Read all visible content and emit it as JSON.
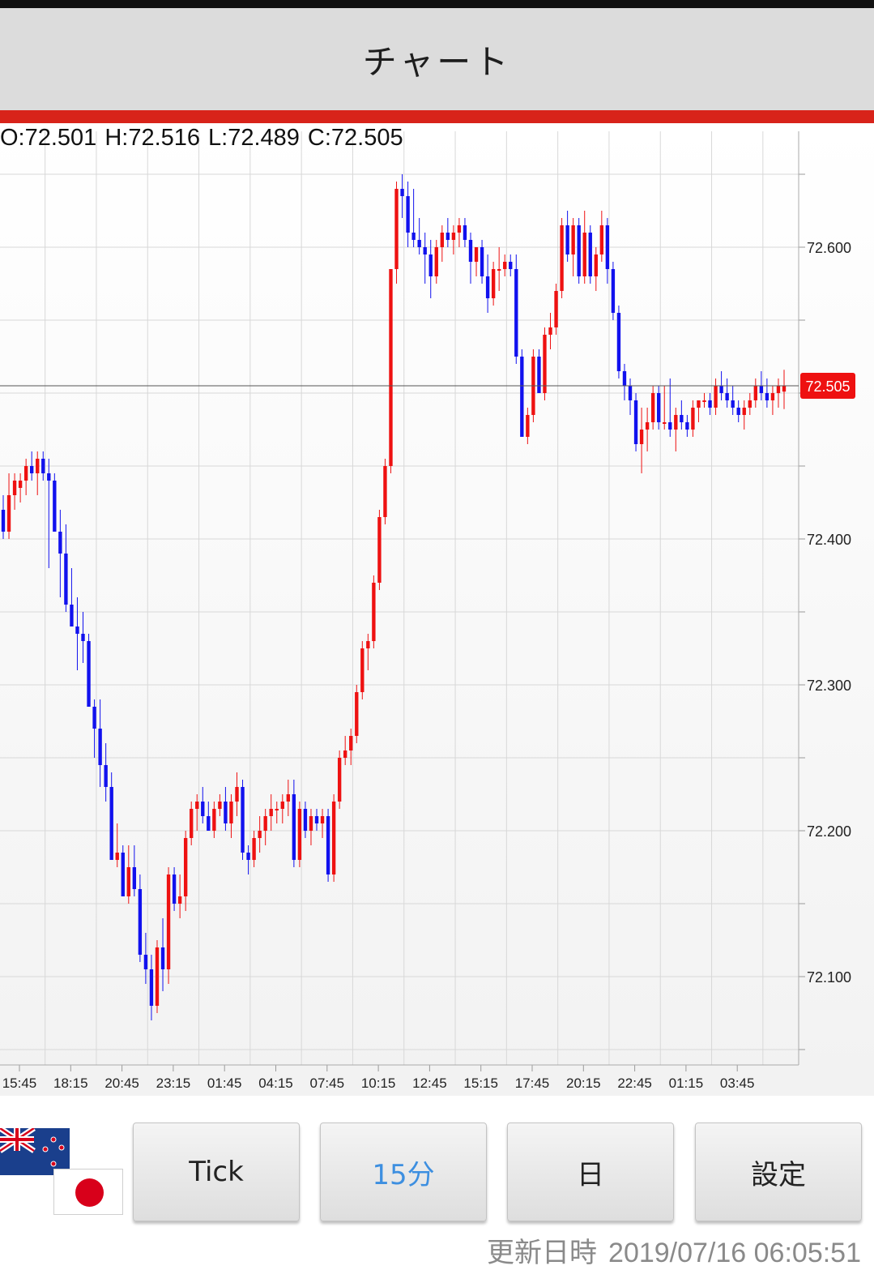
{
  "header": {
    "title": "チャート"
  },
  "ohlc": {
    "open": "O:72.501",
    "high": "H:72.516",
    "low": "L:72.489",
    "close": "C:72.505"
  },
  "buttons": {
    "tick": "Tick",
    "m15": "15分",
    "day": "日",
    "settings": "設定"
  },
  "footer": {
    "update_label": "更新日時",
    "update_value": "2019/07/16 06:05:51"
  },
  "colors": {
    "up": "#ee1111",
    "down": "#1111ee",
    "accent": "#d8231a",
    "header_bg": "#dcdcdc",
    "active_button_text": "#3d8fe0"
  },
  "icons": {
    "flag_top": "new-zealand-flag-icon",
    "flag_bottom": "japan-flag-icon"
  },
  "chart_data": {
    "type": "candlestick",
    "ylim": [
      72.045,
      72.665
    ],
    "yticks": [
      72.1,
      72.2,
      72.3,
      72.4,
      72.6
    ],
    "ytick_labels": [
      "72.100",
      "72.200",
      "72.300",
      "72.400",
      "72.600"
    ],
    "x_tick_labels": [
      "15:45",
      "18:15",
      "20:45",
      "23:15",
      "01:45",
      "04:15",
      "07:45",
      "10:15",
      "12:45",
      "15:15",
      "17:45",
      "20:15",
      "22:45",
      "01:15",
      "03:45"
    ],
    "current_price": 72.505,
    "current_price_label": "72.505",
    "grid": true,
    "candles": [
      [
        72.42,
        72.43,
        72.4,
        72.405
      ],
      [
        72.405,
        72.445,
        72.4,
        72.43
      ],
      [
        72.43,
        72.445,
        72.42,
        72.44
      ],
      [
        72.435,
        72.445,
        72.425,
        72.44
      ],
      [
        72.44,
        72.455,
        72.43,
        72.45
      ],
      [
        72.45,
        72.46,
        72.44,
        72.445
      ],
      [
        72.445,
        72.46,
        72.43,
        72.455
      ],
      [
        72.455,
        72.46,
        72.44,
        72.445
      ],
      [
        72.445,
        72.455,
        72.38,
        72.44
      ],
      [
        72.44,
        72.445,
        72.405,
        72.405
      ],
      [
        72.405,
        72.42,
        72.36,
        72.39
      ],
      [
        72.39,
        72.41,
        72.35,
        72.355
      ],
      [
        72.355,
        72.38,
        72.34,
        72.34
      ],
      [
        72.34,
        72.36,
        72.31,
        72.335
      ],
      [
        72.335,
        72.35,
        72.315,
        72.33
      ],
      [
        72.33,
        72.335,
        72.285,
        72.285
      ],
      [
        72.285,
        72.29,
        72.25,
        72.27
      ],
      [
        72.27,
        72.29,
        72.23,
        72.245
      ],
      [
        72.245,
        72.26,
        72.22,
        72.23
      ],
      [
        72.23,
        72.24,
        72.18,
        72.18
      ],
      [
        72.18,
        72.205,
        72.175,
        72.185
      ],
      [
        72.185,
        72.19,
        72.155,
        72.155
      ],
      [
        72.155,
        72.19,
        72.15,
        72.175
      ],
      [
        72.175,
        72.19,
        72.155,
        72.16
      ],
      [
        72.16,
        72.17,
        72.11,
        72.115
      ],
      [
        72.115,
        72.13,
        72.095,
        72.105
      ],
      [
        72.105,
        72.115,
        72.07,
        72.08
      ],
      [
        72.08,
        72.125,
        72.075,
        72.12
      ],
      [
        72.12,
        72.14,
        72.09,
        72.105
      ],
      [
        72.105,
        72.175,
        72.095,
        72.17
      ],
      [
        72.17,
        72.175,
        72.145,
        72.15
      ],
      [
        72.15,
        72.17,
        72.14,
        72.155
      ],
      [
        72.155,
        72.2,
        72.145,
        72.195
      ],
      [
        72.195,
        72.22,
        72.19,
        72.215
      ],
      [
        72.215,
        72.225,
        72.2,
        72.22
      ],
      [
        72.22,
        72.23,
        72.205,
        72.21
      ],
      [
        72.21,
        72.22,
        72.2,
        72.2
      ],
      [
        72.2,
        72.22,
        72.195,
        72.215
      ],
      [
        72.215,
        72.225,
        72.21,
        72.22
      ],
      [
        72.22,
        72.23,
        72.2,
        72.205
      ],
      [
        72.205,
        72.225,
        72.195,
        72.22
      ],
      [
        72.22,
        72.24,
        72.21,
        72.23
      ],
      [
        72.23,
        72.235,
        72.18,
        72.185
      ],
      [
        72.185,
        72.19,
        72.17,
        72.18
      ],
      [
        72.18,
        72.2,
        72.175,
        72.195
      ],
      [
        72.195,
        72.21,
        72.185,
        72.2
      ],
      [
        72.2,
        72.215,
        72.19,
        72.21
      ],
      [
        72.21,
        72.225,
        72.2,
        72.215
      ],
      [
        72.215,
        72.22,
        72.205,
        72.215
      ],
      [
        72.215,
        72.225,
        72.205,
        72.22
      ],
      [
        72.22,
        72.235,
        72.21,
        72.225
      ],
      [
        72.225,
        72.235,
        72.175,
        72.18
      ],
      [
        72.18,
        72.22,
        72.175,
        72.215
      ],
      [
        72.215,
        72.22,
        72.195,
        72.2
      ],
      [
        72.2,
        72.215,
        72.19,
        72.21
      ],
      [
        72.21,
        72.215,
        72.2,
        72.205
      ],
      [
        72.205,
        72.215,
        72.195,
        72.21
      ],
      [
        72.21,
        72.215,
        72.165,
        72.17
      ],
      [
        72.17,
        72.225,
        72.165,
        72.22
      ],
      [
        72.22,
        72.255,
        72.215,
        72.25
      ],
      [
        72.25,
        72.265,
        72.245,
        72.255
      ],
      [
        72.255,
        72.27,
        72.245,
        72.265
      ],
      [
        72.265,
        72.3,
        72.26,
        72.295
      ],
      [
        72.295,
        72.33,
        72.29,
        72.325
      ],
      [
        72.325,
        72.335,
        72.31,
        72.33
      ],
      [
        72.33,
        72.375,
        72.325,
        72.37
      ],
      [
        72.37,
        72.42,
        72.365,
        72.415
      ],
      [
        72.415,
        72.455,
        72.41,
        72.45
      ],
      [
        72.45,
        72.585,
        72.445,
        72.585
      ],
      [
        72.585,
        72.645,
        72.575,
        72.64
      ],
      [
        72.64,
        72.65,
        72.62,
        72.635
      ],
      [
        72.635,
        72.645,
        72.6,
        72.61
      ],
      [
        72.61,
        72.64,
        72.6,
        72.605
      ],
      [
        72.605,
        72.62,
        72.595,
        72.6
      ],
      [
        72.6,
        72.61,
        72.575,
        72.595
      ],
      [
        72.595,
        72.605,
        72.565,
        72.58
      ],
      [
        72.58,
        72.605,
        72.575,
        72.6
      ],
      [
        72.6,
        72.615,
        72.59,
        72.61
      ],
      [
        72.61,
        72.62,
        72.6,
        72.605
      ],
      [
        72.605,
        72.615,
        72.595,
        72.61
      ],
      [
        72.61,
        72.62,
        72.6,
        72.615
      ],
      [
        72.615,
        72.62,
        72.6,
        72.605
      ],
      [
        72.605,
        72.61,
        72.575,
        72.59
      ],
      [
        72.59,
        72.6,
        72.58,
        72.6
      ],
      [
        72.6,
        72.605,
        72.575,
        72.58
      ],
      [
        72.58,
        72.595,
        72.555,
        72.565
      ],
      [
        72.565,
        72.59,
        72.56,
        72.585
      ],
      [
        72.585,
        72.6,
        72.57,
        72.585
      ],
      [
        72.585,
        72.595,
        72.58,
        72.59
      ],
      [
        72.59,
        72.595,
        72.58,
        72.585
      ],
      [
        72.585,
        72.595,
        72.52,
        72.525
      ],
      [
        72.525,
        72.53,
        72.47,
        72.47
      ],
      [
        72.47,
        72.49,
        72.465,
        72.485
      ],
      [
        72.485,
        72.53,
        72.48,
        72.525
      ],
      [
        72.525,
        72.53,
        72.5,
        72.5
      ],
      [
        72.5,
        72.545,
        72.495,
        72.54
      ],
      [
        72.54,
        72.555,
        72.53,
        72.545
      ],
      [
        72.545,
        72.575,
        72.54,
        72.57
      ],
      [
        72.57,
        72.62,
        72.565,
        72.615
      ],
      [
        72.615,
        72.625,
        72.59,
        72.595
      ],
      [
        72.595,
        72.62,
        72.58,
        72.615
      ],
      [
        72.615,
        72.62,
        72.575,
        72.58
      ],
      [
        72.58,
        72.625,
        72.575,
        72.61
      ],
      [
        72.61,
        72.615,
        72.575,
        72.58
      ],
      [
        72.58,
        72.6,
        72.57,
        72.595
      ],
      [
        72.595,
        72.625,
        72.59,
        72.615
      ],
      [
        72.615,
        72.62,
        72.575,
        72.585
      ],
      [
        72.585,
        72.59,
        72.55,
        72.555
      ],
      [
        72.555,
        72.56,
        72.51,
        72.515
      ],
      [
        72.515,
        72.52,
        72.495,
        72.505
      ],
      [
        72.505,
        72.51,
        72.485,
        72.495
      ],
      [
        72.495,
        72.5,
        72.46,
        72.465
      ],
      [
        72.465,
        72.49,
        72.445,
        72.475
      ],
      [
        72.475,
        72.49,
        72.46,
        72.48
      ],
      [
        72.48,
        72.505,
        72.475,
        72.5
      ],
      [
        72.5,
        72.505,
        72.475,
        72.48
      ],
      [
        72.48,
        72.505,
        72.475,
        72.48
      ],
      [
        72.48,
        72.51,
        72.47,
        72.475
      ],
      [
        72.475,
        72.49,
        72.46,
        72.485
      ],
      [
        72.485,
        72.495,
        72.475,
        72.48
      ],
      [
        72.48,
        72.485,
        72.47,
        72.475
      ],
      [
        72.475,
        72.495,
        72.47,
        72.49
      ],
      [
        72.49,
        72.495,
        72.48,
        72.495
      ],
      [
        72.495,
        72.5,
        72.49,
        72.495
      ],
      [
        72.495,
        72.5,
        72.485,
        72.49
      ],
      [
        72.49,
        72.51,
        72.485,
        72.505
      ],
      [
        72.505,
        72.515,
        72.495,
        72.5
      ],
      [
        72.5,
        72.51,
        72.49,
        72.495
      ],
      [
        72.495,
        72.505,
        72.485,
        72.49
      ],
      [
        72.49,
        72.495,
        72.48,
        72.485
      ],
      [
        72.485,
        72.495,
        72.475,
        72.49
      ],
      [
        72.49,
        72.5,
        72.485,
        72.495
      ],
      [
        72.495,
        72.51,
        72.49,
        72.505
      ],
      [
        72.505,
        72.515,
        72.495,
        72.5
      ],
      [
        72.5,
        72.51,
        72.49,
        72.495
      ],
      [
        72.495,
        72.505,
        72.485,
        72.5
      ],
      [
        72.5,
        72.51,
        72.49,
        72.505
      ],
      [
        72.501,
        72.516,
        72.489,
        72.505
      ]
    ]
  }
}
